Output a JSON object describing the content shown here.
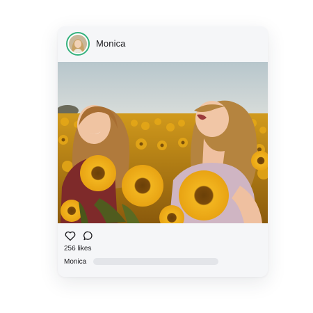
{
  "post": {
    "username": "Monica",
    "likes_text": "256 likes",
    "caption_user": "Monica"
  },
  "icons": {
    "avatar": "avatar-icon",
    "like": "heart-icon",
    "comment": "comment-icon"
  },
  "colors": {
    "card_background": "#f5f6f8",
    "avatar_ring": "#35b27e",
    "text": "#1b1b1f",
    "caption_placeholder": "#e3e5e9"
  }
}
